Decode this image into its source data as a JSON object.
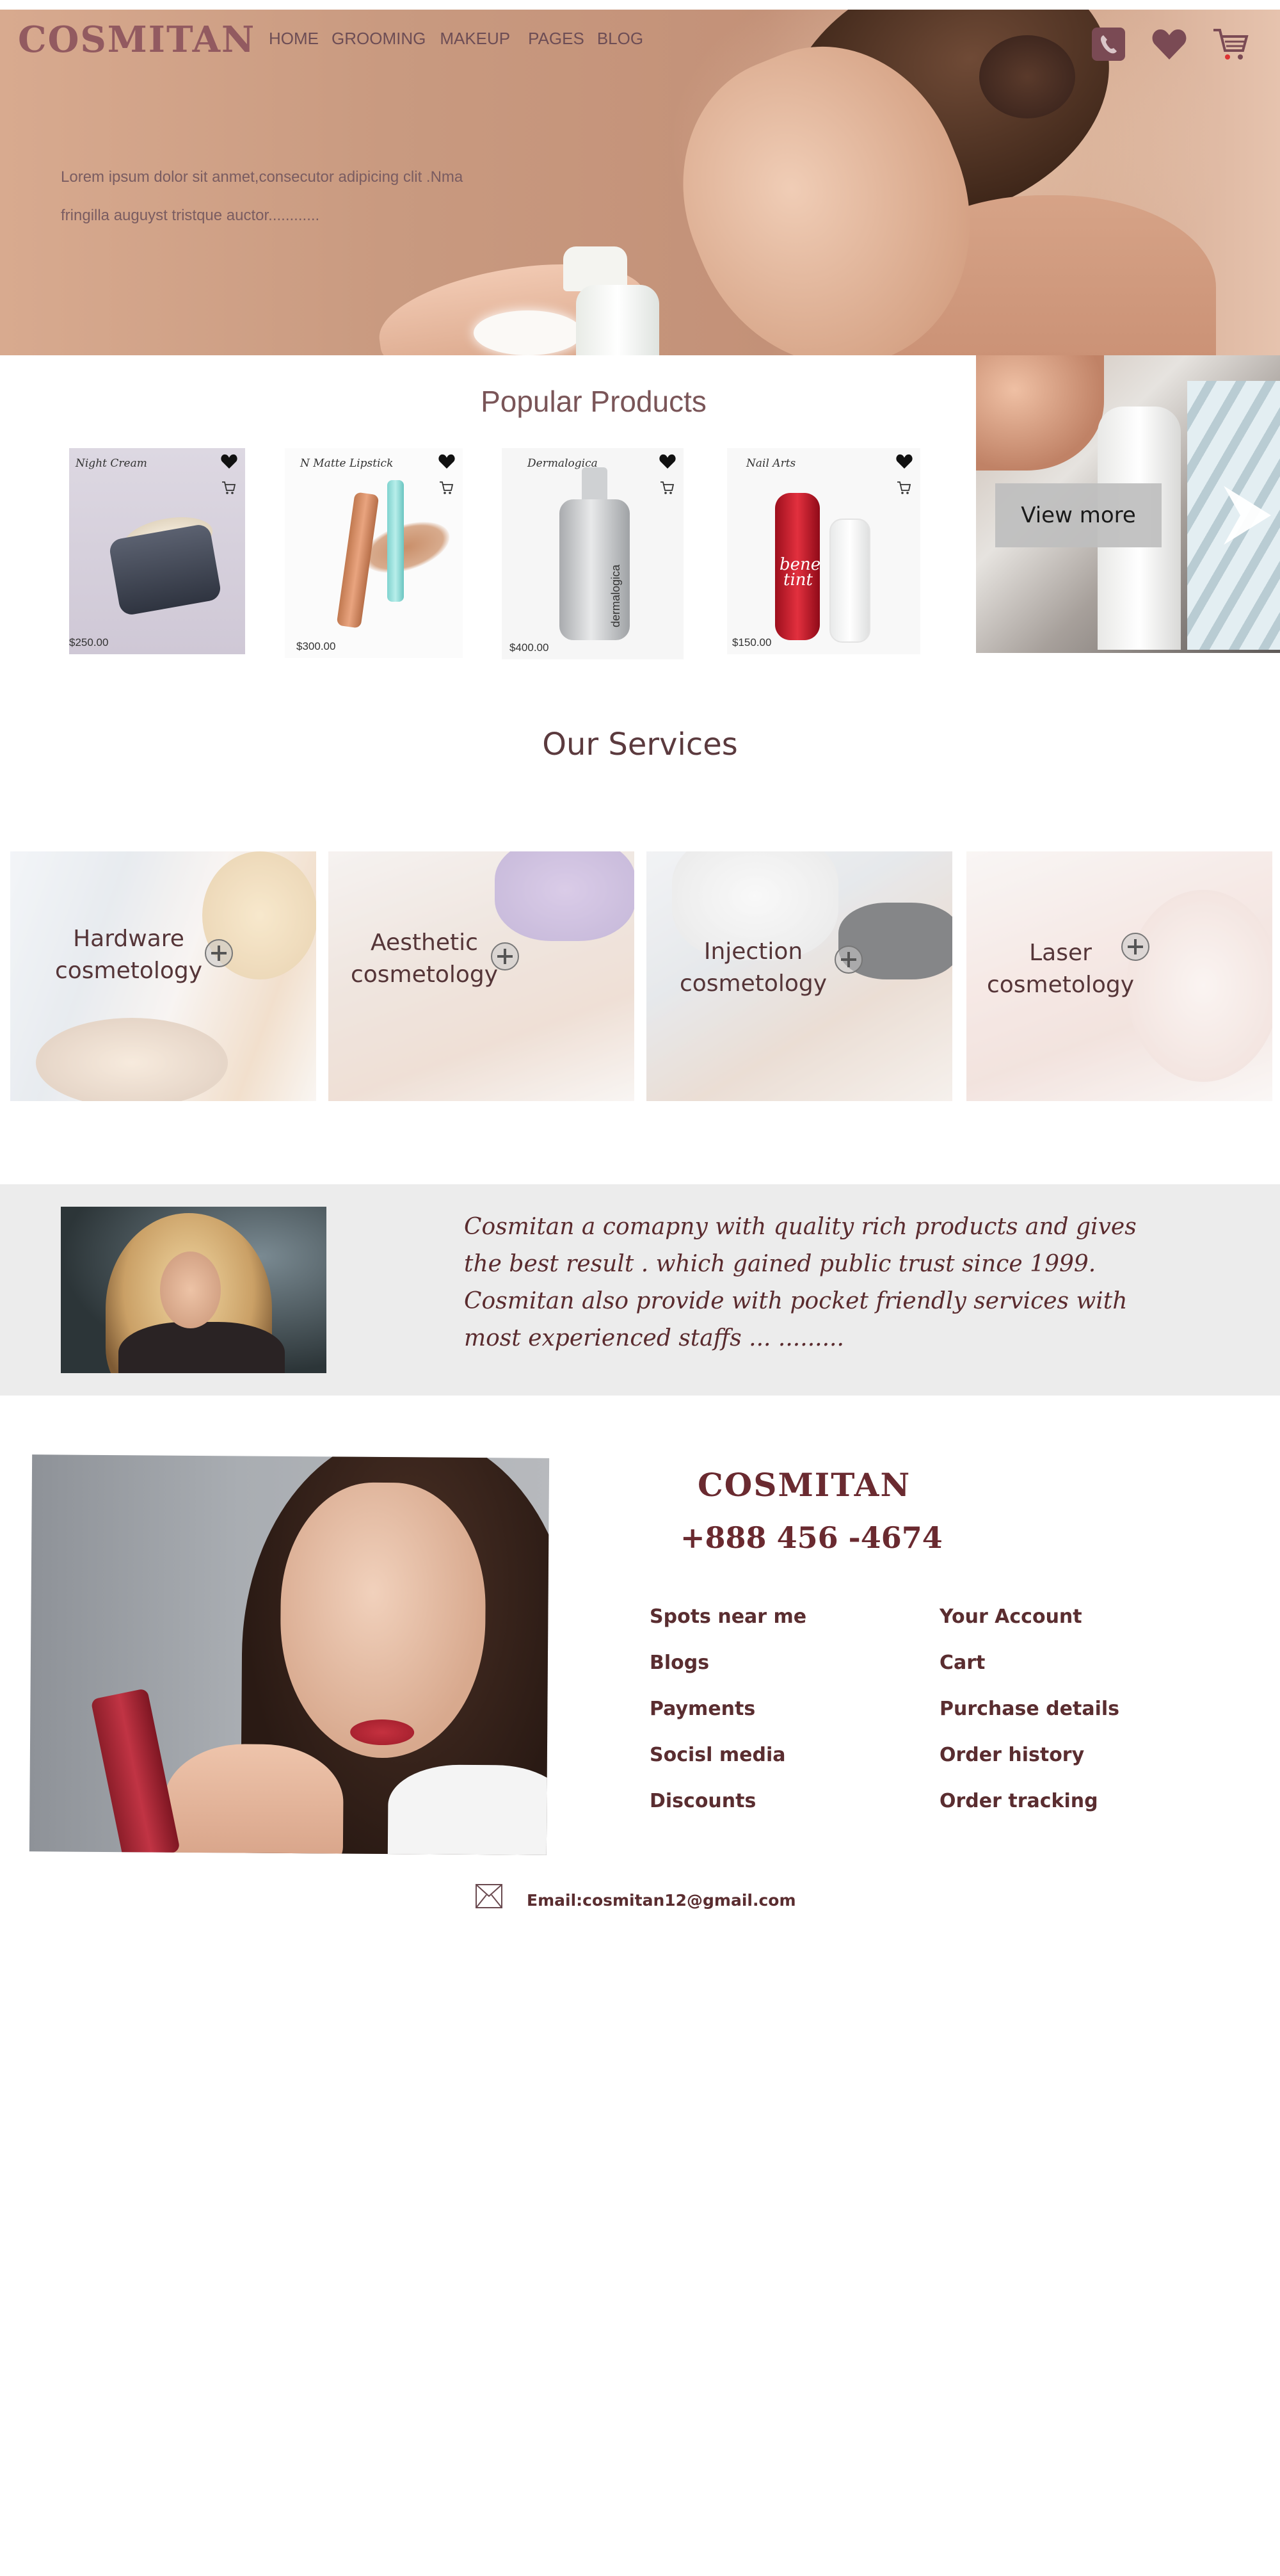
{
  "header": {
    "brand": "COSMITAN",
    "nav": [
      "HOME",
      "GROOMING",
      "MAKEUP",
      "PAGES",
      "BLOG"
    ],
    "icons": [
      "phone-icon",
      "heart-icon",
      "cart-icon"
    ],
    "hero_line_1": "Lorem ipsum dolor   sit anmet,consecutor  adipicing clit  .Nma",
    "hero_line_2": "fringilla auguyst  tristque auctor............"
  },
  "products": {
    "title": "Popular Products",
    "items": [
      {
        "name": "Night  Cream",
        "price": "$250.00"
      },
      {
        "name": "N Matte Lipstick",
        "price": "$300.00"
      },
      {
        "name": "Dermalogica",
        "price": "$400.00"
      },
      {
        "name": "Nail Arts",
        "price": "$150.00"
      }
    ],
    "view_more": "View more",
    "bottle_labels": {
      "derm": "dermalogica",
      "tint": "bene tint"
    }
  },
  "services": {
    "title": "Our  Services",
    "items": [
      {
        "line1": "Hardware",
        "line2": "cosmetology"
      },
      {
        "line1": "Aesthetic",
        "line2": "cosmetology"
      },
      {
        "line1": "Injection",
        "line2": "cosmetology"
      },
      {
        "line1": "Laser",
        "line2": "cosmetology"
      }
    ]
  },
  "about": {
    "text": "Cosmitan  a  comapny  with  quality  rich  products  and  gives the  best  result . which  gained  public  trust  since   1999. Cosmitan  also  provide   with  pocket friendly  services  with  most  experienced   staffs  ... ........."
  },
  "footer": {
    "brand": "COSMITAN",
    "phone": "+888 456 -4674",
    "links_left": [
      "Spots  near me",
      "Blogs",
      "Payments",
      "Socisl media",
      "Discounts"
    ],
    "links_right": [
      "Your  Account",
      "Cart",
      "Purchase details",
      "Order  history",
      "Order  tracking"
    ],
    "email": "Email:cosmitan12@gmail.com"
  },
  "colors": {
    "brand": "#925a60",
    "accent_dark": "#5a2d30",
    "strip_bg": "#ececec"
  }
}
